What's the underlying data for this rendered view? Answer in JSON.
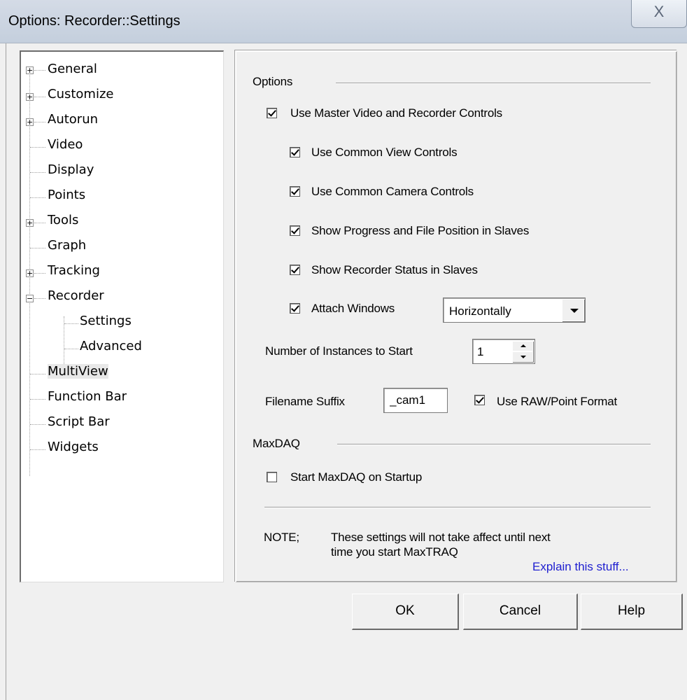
{
  "window": {
    "title": "Options: Recorder::Settings",
    "close_glyph": "X"
  },
  "tree": {
    "items": [
      {
        "label": "General",
        "expander": "+"
      },
      {
        "label": "Customize",
        "expander": "+"
      },
      {
        "label": "Autorun",
        "expander": "+"
      },
      {
        "label": "Video",
        "expander": ""
      },
      {
        "label": "Display",
        "expander": ""
      },
      {
        "label": "Points",
        "expander": ""
      },
      {
        "label": "Tools",
        "expander": "+"
      },
      {
        "label": "Graph",
        "expander": ""
      },
      {
        "label": "Tracking",
        "expander": "+"
      },
      {
        "label": "Recorder",
        "expander": "−"
      },
      {
        "label": "Settings",
        "expander": ""
      },
      {
        "label": "Advanced",
        "expander": ""
      },
      {
        "label": "MultiView",
        "expander": ""
      },
      {
        "label": "Function Bar",
        "expander": ""
      },
      {
        "label": "Script Bar",
        "expander": ""
      },
      {
        "label": "Widgets",
        "expander": ""
      }
    ],
    "selected": "MultiView"
  },
  "panel": {
    "options_header": "Options",
    "checkboxes": [
      {
        "label": "Use Master Video and Recorder Controls",
        "checked": true
      },
      {
        "label": "Use Common View Controls",
        "checked": true
      },
      {
        "label": "Use Common Camera Controls",
        "checked": true
      },
      {
        "label": "Show Progress and File Position in Slaves",
        "checked": true
      },
      {
        "label": "Show Recorder Status in Slaves",
        "checked": true
      },
      {
        "label": "Attach Windows",
        "checked": true
      }
    ],
    "attach_dropdown_value": "Horizontally",
    "instances_label": "Number of Instances to Start",
    "instances_value": "1",
    "filename_suffix_label": "Filename Suffix",
    "filename_suffix_value": "_cam1",
    "raw_format_label": "Use RAW/Point Format",
    "raw_format_checked": true,
    "maxdaq_header": "MaxDAQ",
    "maxdaq_startup_label": "Start MaxDAQ on Startup",
    "maxdaq_startup_checked": false,
    "note_label": "NOTE;",
    "note_line1": "These settings will not take affect until next",
    "note_line2": "time you start MaxTRAQ",
    "explain_link": "Explain this stuff..."
  },
  "buttons": {
    "ok": "OK",
    "cancel": "Cancel",
    "help": "Help"
  }
}
